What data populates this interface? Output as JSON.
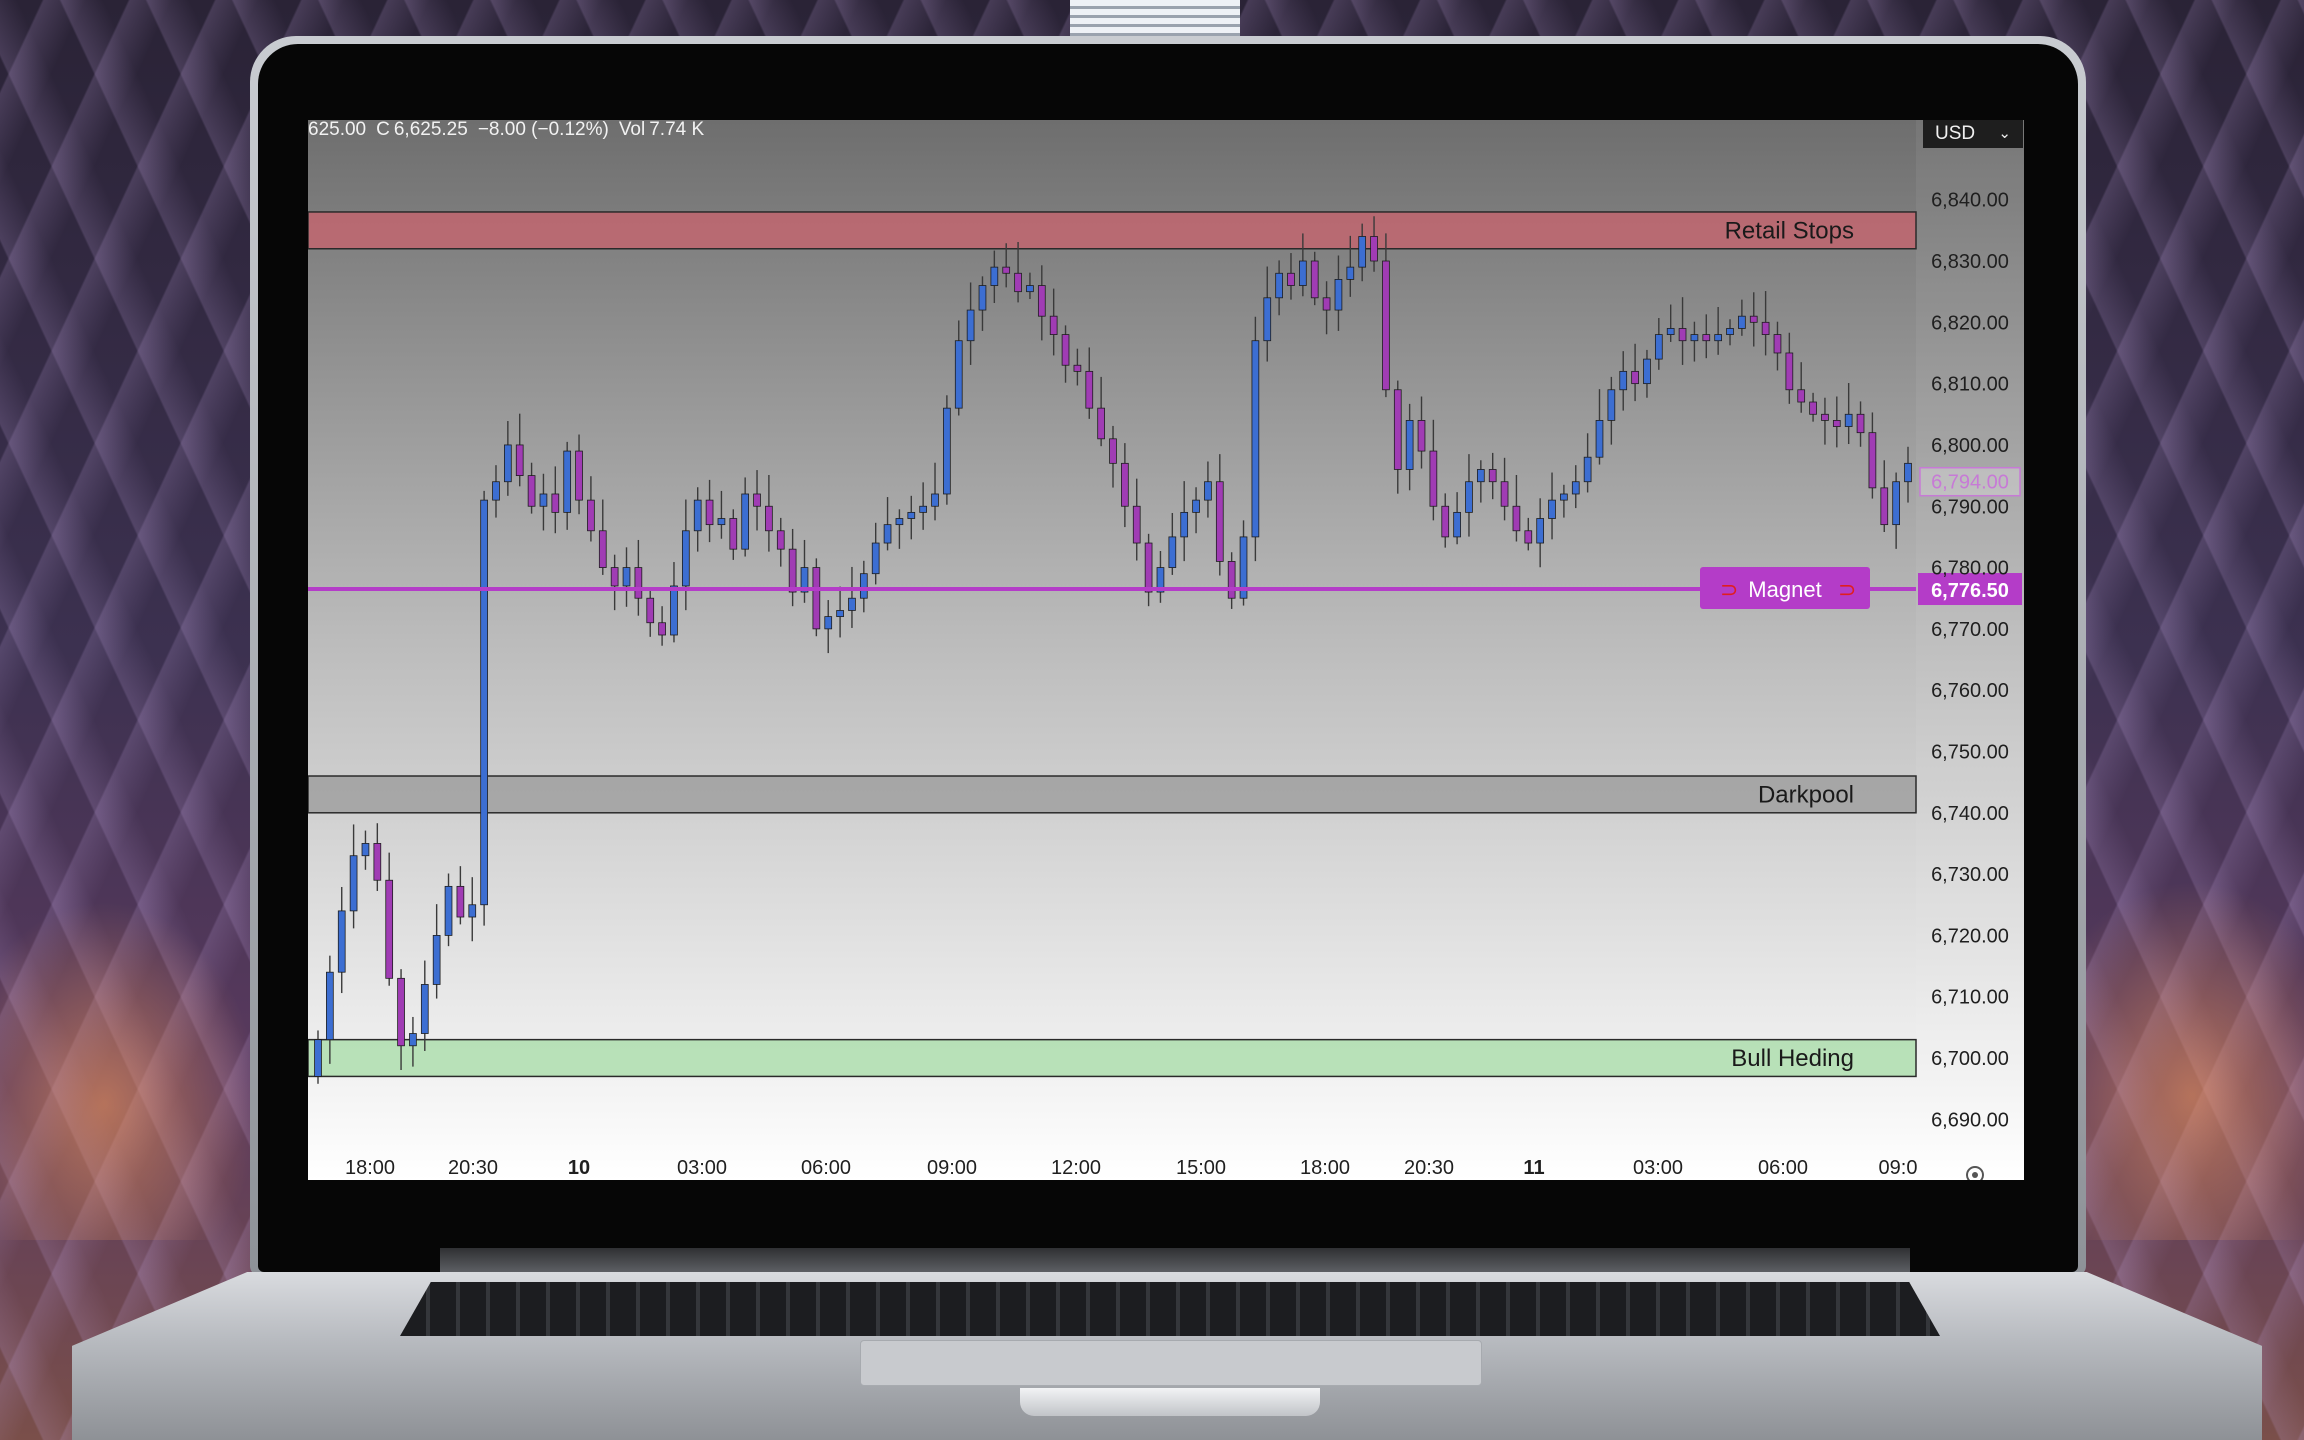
{
  "header": {
    "ohlc_open": "625.00",
    "ohlc_close_label": "C",
    "ohlc_close": "6,625.25",
    "ohlc_change": "−8.00 (−0.12%)",
    "volume_label": "Vol",
    "volume": "7.74 K",
    "currency": "USD",
    "currency_icon": "chevron-down-icon"
  },
  "colors": {
    "bull_candle": "#3c6ed2",
    "bear_candle": "#a03cb4",
    "magnet_line": "#b43cc8",
    "retail_zone": "#c8646e",
    "darkpool_zone": "#9b9b9b",
    "bull_zone": "#a8dca8"
  },
  "chart_data": {
    "type": "candlestick",
    "ylim": [
      6685,
      6853
    ],
    "y_ticks": [
      6690,
      6700,
      6710,
      6720,
      6730,
      6740,
      6750,
      6760,
      6770,
      6780,
      6790,
      6800,
      6810,
      6820,
      6830,
      6840
    ],
    "y_tick_labels": [
      "6,690.00",
      "6,700.00",
      "6,710.00",
      "6,720.00",
      "6,730.00",
      "6,740.00",
      "6,750.00",
      "6,760.00",
      "6,770.00",
      "6,780.00",
      "6,790.00",
      "6,800.00",
      "6,810.00",
      "6,820.00",
      "6,830.00",
      "6,840.00"
    ],
    "x_tick_labels": [
      "18:00",
      "20:30",
      "10",
      "03:00",
      "06:00",
      "09:00",
      "12:00",
      "15:00",
      "18:00",
      "20:30",
      "11",
      "03:00",
      "06:00",
      "09:0"
    ],
    "x_tick_bold": [
      false,
      false,
      true,
      false,
      false,
      false,
      false,
      false,
      false,
      false,
      true,
      false,
      false,
      false
    ],
    "zones": [
      {
        "name": "Retail Stops",
        "low": 6832,
        "high": 6838,
        "color": "#c8646e"
      },
      {
        "name": "Darkpool",
        "low": 6740,
        "high": 6746,
        "color": "#9b9b9b"
      },
      {
        "name": "Bull Heding",
        "low": 6697,
        "high": 6703,
        "color": "#a8dca8"
      }
    ],
    "magnet": {
      "label": "Magnet",
      "price": 6776.5,
      "price_label": "6,776.50",
      "icon": "magnet-icon"
    },
    "current_price": {
      "price": 6794,
      "label": "6,794.00"
    },
    "closes": [
      6703,
      6714,
      6724,
      6733,
      6735,
      6729,
      6713,
      6702,
      6704,
      6712,
      6720,
      6728,
      6723,
      6725,
      6791,
      6794,
      6800,
      6795,
      6790,
      6792,
      6789,
      6799,
      6791,
      6786,
      6780,
      6777,
      6780,
      6775,
      6771,
      6769,
      6777,
      6786,
      6791,
      6787,
      6788,
      6783,
      6792,
      6790,
      6786,
      6783,
      6776,
      6780,
      6770,
      6772,
      6773,
      6775,
      6779,
      6784,
      6787,
      6788,
      6789,
      6790,
      6792,
      6806,
      6817,
      6822,
      6826,
      6829,
      6828,
      6825,
      6826,
      6821,
      6818,
      6813,
      6812,
      6806,
      6801,
      6797,
      6790,
      6784,
      6776,
      6780,
      6785,
      6789,
      6791,
      6794,
      6781,
      6775,
      6785,
      6817,
      6824,
      6828,
      6826,
      6830,
      6824,
      6822,
      6827,
      6829,
      6834,
      6830,
      6809,
      6796,
      6804,
      6799,
      6790,
      6785,
      6789,
      6794,
      6796,
      6794,
      6790,
      6786,
      6784,
      6788,
      6791,
      6792,
      6794,
      6798,
      6804,
      6809,
      6812,
      6810,
      6814,
      6818,
      6819,
      6817,
      6818,
      6817,
      6818,
      6819,
      6821,
      6820,
      6818,
      6815,
      6809,
      6807,
      6805,
      6804,
      6803,
      6805,
      6802,
      6793,
      6787,
      6794,
      6797
    ]
  }
}
